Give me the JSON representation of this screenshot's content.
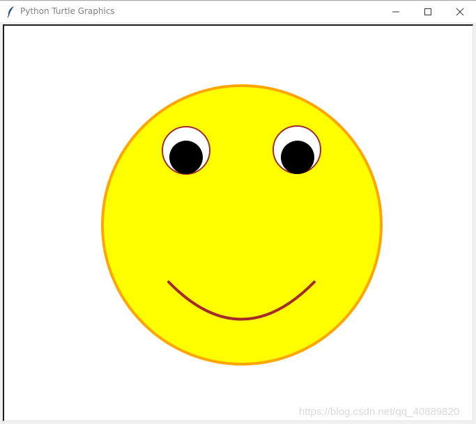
{
  "window": {
    "title": "Python Turtle Graphics",
    "app_icon": "feather-icon",
    "controls": {
      "minimize": "minimize-icon",
      "maximize": "maximize-icon",
      "close": "close-icon"
    }
  },
  "canvas": {
    "background": "#ffffff",
    "drawing": {
      "face_fill": "#ffff00",
      "face_outline": "#ffa500",
      "eye_white_fill": "#ffffff",
      "eye_outline": "#a52a2a",
      "pupil_fill": "#000000",
      "smile_color": "#a52a2a"
    }
  },
  "watermark": "https://blog.csdn.net/qq_40889820"
}
